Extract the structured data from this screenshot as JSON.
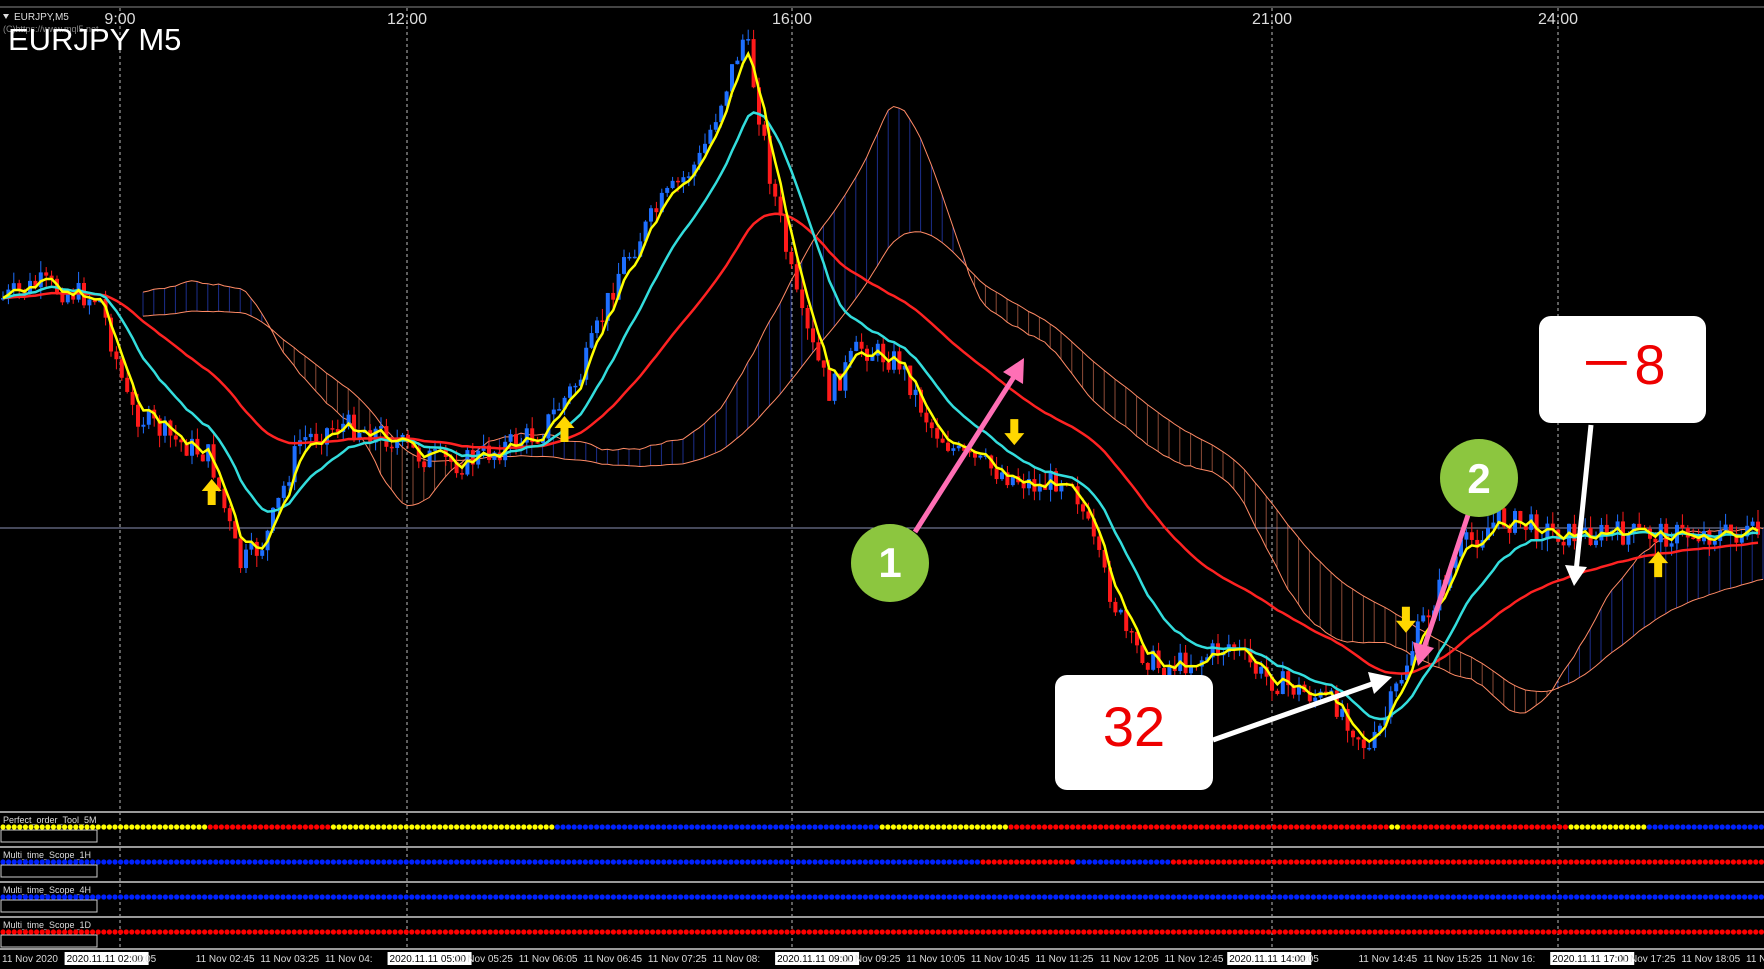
{
  "window": {
    "symbol_tab": "EURJPY,M5",
    "copyright": "(C)https://www.mql5.net",
    "chart_title": "EURJPY M5"
  },
  "colors": {
    "background": "#000000",
    "bull_candle": "#1e6fff",
    "bear_candle": "#ff1a1a",
    "ema_fast": "#ffff00",
    "ema_mid": "#33dddd",
    "ema_slow": "#ff2222",
    "cloud_bear": "#ff8a65",
    "cloud_bull": "#3355ff",
    "arrow_signal": "#ffd700",
    "callout_pink": "#ff6fb5",
    "callout_green": "#8cc63f",
    "dot_yellow": "#ffff00",
    "dot_red": "#ff0000",
    "dot_blue": "#0022ff"
  },
  "chart_data": {
    "type": "candlestick",
    "symbol": "EURJPY",
    "timeframe": "M5",
    "top_time_labels": [
      "9:00",
      "12:00",
      "16:00",
      "21:00",
      "24:00"
    ],
    "bottom_time_labels": [
      "11 Nov 2020",
      "2020.11.11 02:00",
      "02:05",
      "11 Nov 02:45",
      "11 Nov 03:25",
      "11 Nov 04:",
      "2020.11.11 05:00",
      "11 Nov 05:25",
      "11 Nov 06:05",
      "11 Nov 06:45",
      "11 Nov 07:25",
      "11 Nov 08:",
      "2020.11.11 09:00",
      "11 Nov 09:25",
      "11 Nov 10:05",
      "11 Nov 10:45",
      "11 Nov 11:25",
      "11 Nov 12:05",
      "11 Nov 12:45",
      "2020.11.11 14:00",
      "14:05",
      "11 Nov 14:45",
      "11 Nov 15:25",
      "11 Nov 16:",
      "2020.11.11 17:00",
      "11 Nov 17:25",
      "11 Nov 18:05",
      "11 Nov 1"
    ],
    "price_profile_rel": [
      [
        0,
        0.64
      ],
      [
        40,
        0.66
      ],
      [
        100,
        0.64
      ],
      [
        130,
        0.5
      ],
      [
        175,
        0.46
      ],
      [
        210,
        0.44
      ],
      [
        240,
        0.3
      ],
      [
        265,
        0.33
      ],
      [
        300,
        0.46
      ],
      [
        340,
        0.48
      ],
      [
        380,
        0.47
      ],
      [
        420,
        0.44
      ],
      [
        460,
        0.43
      ],
      [
        500,
        0.45
      ],
      [
        540,
        0.47
      ],
      [
        580,
        0.54
      ],
      [
        620,
        0.68
      ],
      [
        660,
        0.76
      ],
      [
        700,
        0.82
      ],
      [
        745,
        0.98
      ],
      [
        770,
        0.8
      ],
      [
        800,
        0.62
      ],
      [
        830,
        0.52
      ],
      [
        860,
        0.58
      ],
      [
        900,
        0.56
      ],
      [
        930,
        0.48
      ],
      [
        960,
        0.44
      ],
      [
        1000,
        0.42
      ],
      [
        1040,
        0.4
      ],
      [
        1070,
        0.42
      ],
      [
        1100,
        0.3
      ],
      [
        1130,
        0.2
      ],
      [
        1160,
        0.17
      ],
      [
        1200,
        0.18
      ],
      [
        1230,
        0.2
      ],
      [
        1260,
        0.16
      ],
      [
        1300,
        0.14
      ],
      [
        1340,
        0.12
      ],
      [
        1370,
        0.06
      ],
      [
        1390,
        0.12
      ],
      [
        1420,
        0.22
      ],
      [
        1460,
        0.32
      ],
      [
        1500,
        0.36
      ],
      [
        1564,
        0.34
      ]
    ],
    "signals": [
      {
        "type": "buy",
        "pos": 0.12
      },
      {
        "type": "buy",
        "pos": 0.32
      },
      {
        "type": "sell",
        "pos": 0.575
      },
      {
        "type": "sell",
        "pos": 0.797
      },
      {
        "type": "buy",
        "pos": 0.94
      }
    ]
  },
  "annotations": {
    "circle_1": "1",
    "circle_2": "2",
    "box_32": "32",
    "box_minus8": "－8"
  },
  "indicators": [
    {
      "name": "Perfect_order_Tool_5M",
      "segments": [
        [
          "yellow",
          0.116
        ],
        [
          "red",
          0.188
        ],
        [
          "yellow",
          0.314
        ],
        [
          "blue",
          0.5
        ],
        [
          "yellow",
          0.573
        ],
        [
          "red",
          0.789
        ],
        [
          "yellow",
          0.795
        ],
        [
          "red",
          0.89
        ],
        [
          "yellow",
          0.935
        ],
        [
          "blue",
          1.0
        ]
      ]
    },
    {
      "name": "Multi_time_Scope_1H",
      "segments": [
        [
          "blue",
          0.555
        ],
        [
          "red",
          0.61
        ],
        [
          "blue",
          0.665
        ],
        [
          "red",
          1.0
        ]
      ]
    },
    {
      "name": "Multi_time_Scope_4H",
      "segments": [
        [
          "blue",
          1.0
        ]
      ]
    },
    {
      "name": "Multi_time_Scope_1D",
      "segments": [
        [
          "red",
          1.0
        ]
      ]
    }
  ]
}
